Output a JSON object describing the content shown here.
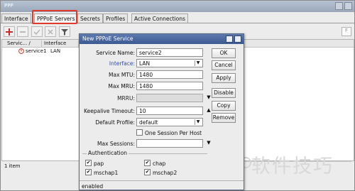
{
  "app": {
    "title": "PPP"
  },
  "tabs": [
    {
      "label": "Interface"
    },
    {
      "label": "PPPoE Servers"
    },
    {
      "label": "Secrets"
    },
    {
      "label": "Profiles"
    },
    {
      "label": "Active Connections"
    }
  ],
  "toolbar": {
    "add_icon": "plus-icon",
    "remove_icon": "minus-icon",
    "enable_icon": "check-icon",
    "disable_icon": "cross-icon",
    "filter_icon": "filter-icon",
    "find_label": "F"
  },
  "list": {
    "columns": [
      "Servic... /",
      "Interface"
    ],
    "rows": [
      {
        "service": "service1",
        "interface": "LAN"
      }
    ],
    "status": "1 item"
  },
  "dialog": {
    "title": "New PPPoE Service",
    "fields": {
      "service_name": {
        "label": "Service Name:",
        "value": "service2"
      },
      "interface": {
        "label": "Interface:",
        "value": "LAN"
      },
      "max_mtu": {
        "label": "Max MTU:",
        "value": "1480"
      },
      "max_mru": {
        "label": "Max MRU:",
        "value": "1480"
      },
      "mrru": {
        "label": "MRRU:",
        "value": ""
      },
      "keepalive_timeout": {
        "label": "Keepalive Timeout:",
        "value": "10"
      },
      "default_profile": {
        "label": "Default Profile:",
        "value": "default"
      },
      "one_session_per_host": {
        "label": "One Session Per Host",
        "checked": false
      },
      "max_sessions": {
        "label": "Max Sessions:",
        "value": ""
      }
    },
    "authentication": {
      "title": "Authentication",
      "pap": {
        "label": "pap",
        "checked": true
      },
      "chap": {
        "label": "chap",
        "checked": true
      },
      "mschap1": {
        "label": "mschap1",
        "checked": true
      },
      "mschap2": {
        "label": "mschap2",
        "checked": true
      }
    },
    "buttons": {
      "ok": "OK",
      "cancel": "Cancel",
      "apply": "Apply",
      "disable": "Disable",
      "copy": "Copy",
      "remove": "Remove"
    },
    "status": "enabled"
  },
  "watermark": {
    "text": "软件技巧"
  },
  "colors": {
    "title_bar": "#9aa8bb",
    "dialog_title": "#3c5a92",
    "link_label": "#2f4bb4",
    "highlight": "#e03a2c",
    "add_icon": "#c62b2b"
  }
}
